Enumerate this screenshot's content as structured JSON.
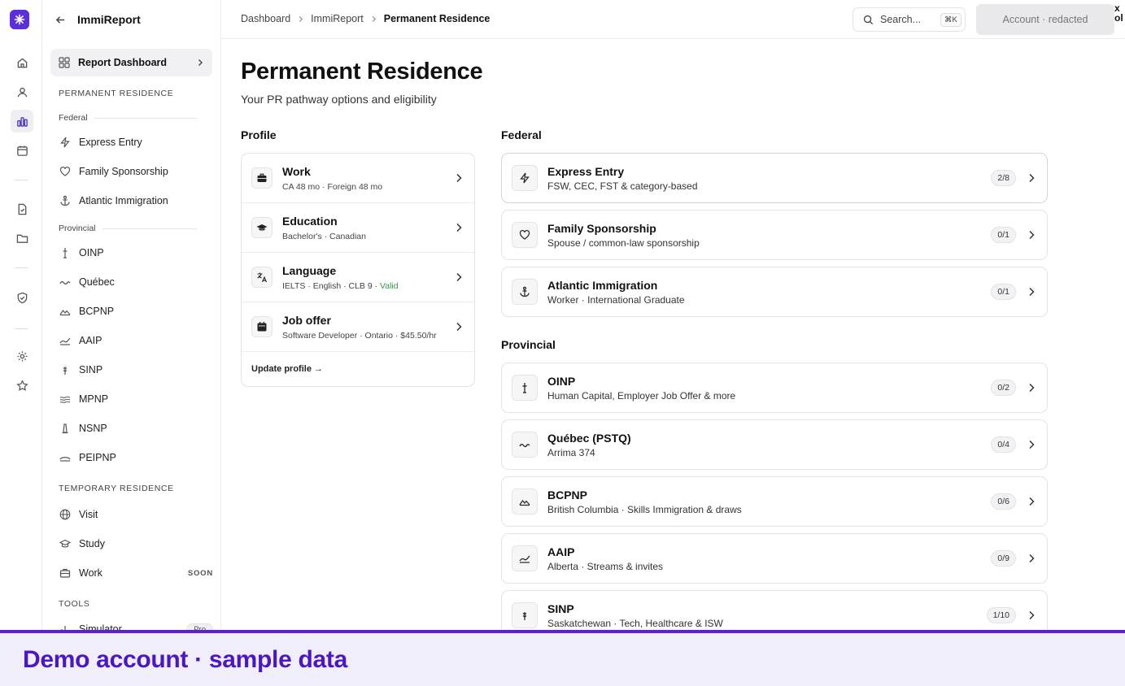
{
  "app": {
    "title": "ImmiReport"
  },
  "breadcrumb": [
    "Dashboard",
    "ImmiReport",
    "Permanent Residence"
  ],
  "search": {
    "placeholder": "Search...",
    "shortcut": "⌘K"
  },
  "account": {
    "label": "Account · redacted"
  },
  "edge_fragment": "x\nol",
  "sidebar": {
    "active_item": "Report Dashboard",
    "sections": {
      "permanent": "PERMANENT RESIDENCE",
      "federal_sub": "Federal",
      "provincial_sub": "Provincial",
      "temporary": "TEMPORARY RESIDENCE",
      "tools": "TOOLS"
    },
    "federal": [
      {
        "label": "Express Entry",
        "icon": "bolt-icon"
      },
      {
        "label": "Family Sponsorship",
        "icon": "heart-icon"
      },
      {
        "label": "Atlantic Immigration",
        "icon": "anchor-icon"
      }
    ],
    "provincial": [
      {
        "label": "OINP",
        "icon": "tower-icon"
      },
      {
        "label": "Québec",
        "icon": "wave-icon"
      },
      {
        "label": "BCPNP",
        "icon": "mountain-icon"
      },
      {
        "label": "AAIP",
        "icon": "hills-icon"
      },
      {
        "label": "SINP",
        "icon": "wheat-icon"
      },
      {
        "label": "MPNP",
        "icon": "waves-icon"
      },
      {
        "label": "NSNP",
        "icon": "lighthouse-icon"
      },
      {
        "label": "PEIPNP",
        "icon": "bridge-icon"
      }
    ],
    "temporary": [
      {
        "label": "Visit",
        "icon": "globe-icon"
      },
      {
        "label": "Study",
        "icon": "graduation-cap-icon"
      },
      {
        "label": "Work",
        "icon": "briefcase-icon",
        "badge": "SOON"
      }
    ],
    "tools": [
      {
        "label": "Simulator",
        "icon": "chart-icon",
        "badge": "Pro"
      }
    ]
  },
  "main": {
    "title": "Permanent Residence",
    "subtitle": "Your PR pathway options and eligibility",
    "profile": {
      "heading": "Profile",
      "rows": [
        {
          "title": "Work",
          "detail": "CA 48 mo · Foreign 48 mo",
          "icon": "briefcase-icon"
        },
        {
          "title": "Education",
          "detail": "Bachelor's · Canadian",
          "icon": "graduation-cap-icon"
        },
        {
          "title": "Language",
          "detail": "IELTS · English · CLB 9 · ",
          "status": "Valid",
          "icon": "translate-icon"
        },
        {
          "title": "Job offer",
          "detail": "Software Developer · Ontario · $45.50/hr",
          "icon": "calendar-icon"
        }
      ],
      "update_link": "Update profile →"
    },
    "federal": {
      "heading": "Federal",
      "programs": [
        {
          "title": "Express Entry",
          "subtitle": "FSW, CEC, FST & category-based",
          "count": "2/8",
          "icon": "bolt-icon"
        },
        {
          "title": "Family Sponsorship",
          "subtitle": "Spouse / common-law sponsorship",
          "count": "0/1",
          "icon": "heart-icon"
        },
        {
          "title": "Atlantic Immigration",
          "subtitle": "Worker · International Graduate",
          "count": "0/1",
          "icon": "anchor-icon"
        }
      ]
    },
    "provincial": {
      "heading": "Provincial",
      "programs": [
        {
          "title": "OINP",
          "subtitle": "Human Capital, Employer Job Offer & more",
          "count": "0/2",
          "icon": "tower-icon"
        },
        {
          "title": "Québec (PSTQ)",
          "subtitle": "Arrima 374",
          "count": "0/4",
          "icon": "wave-icon"
        },
        {
          "title": "BCPNP",
          "subtitle": "British Columbia · Skills Immigration & draws",
          "count": "0/6",
          "icon": "mountain-icon"
        },
        {
          "title": "AAIP",
          "subtitle": "Alberta · Streams & invites",
          "count": "0/9",
          "icon": "hills-icon"
        },
        {
          "title": "SINP",
          "subtitle": "Saskatchewan · Tech, Healthcare & ISW",
          "count": "1/10",
          "icon": "wheat-icon"
        }
      ]
    }
  },
  "banner": {
    "text": "Demo account · sample data"
  },
  "colors": {
    "accent": "#5b2ee0",
    "banner_text": "#4a17c6",
    "valid": "#2f9e44"
  }
}
